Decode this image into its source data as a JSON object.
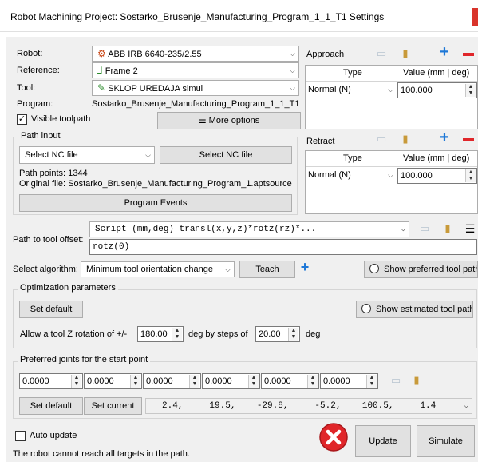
{
  "window": {
    "title": "Robot Machining Project: Sostarko_Brusenje_Manufacturing_Program_1_1_T1 Settings"
  },
  "robot": {
    "label": "Robot:",
    "value": "ABB IRB 6640-235/2.55",
    "icon": "robot-arm-icon"
  },
  "reference": {
    "label": "Reference:",
    "value": "Frame 2",
    "icon": "frame-icon"
  },
  "tool": {
    "label": "Tool:",
    "value": "SKLOP UREDAJA simul",
    "icon": "tool-icon"
  },
  "program": {
    "label": "Program:",
    "value": "Sostarko_Brusenje_Manufacturing_Program_1_1_T1"
  },
  "visible_toolpath": {
    "label": "Visible toolpath",
    "checked": true
  },
  "more_options": {
    "label": "More options",
    "icon": "hamburger-icon"
  },
  "path_input": {
    "title": "Path input",
    "select_value": "Select NC file",
    "button_label": "Select NC file",
    "path_points": "Path points: 1344",
    "original_file": "Original file: Sostarko_Brusenje_Manufacturing_Program_1.aptsource",
    "events_label": "Program Events"
  },
  "approach": {
    "label": "Approach",
    "col_type": "Type",
    "col_value": "Value (mm | deg)",
    "row_type": "Normal (N)",
    "row_value": "100.000"
  },
  "retract": {
    "label": "Retract",
    "col_type": "Type",
    "col_value": "Value (mm | deg)",
    "row_type": "Normal (N)",
    "row_value": "100.000"
  },
  "offset": {
    "label": "Path to tool offset:",
    "script": "Script (mm,deg) transl(x,y,z)*rotz(rz)*...",
    "value": "rotz(0)"
  },
  "algorithm": {
    "label": "Select algorithm:",
    "value": "Minimum tool orientation change",
    "teach_label": "Teach",
    "show_preferred": "Show preferred tool path"
  },
  "optimization": {
    "title": "Optimization parameters",
    "set_default": "Set default",
    "show_estimated": "Show estimated tool path",
    "rotation_prefix": "Allow a tool Z rotation of +/-",
    "rotation_value": "180.00",
    "rotation_middle": "deg by steps of",
    "step_value": "20.00",
    "rotation_suffix": "deg"
  },
  "preferred": {
    "title": "Preferred joints for the start point",
    "joints": [
      "0.0000",
      "0.0000",
      "0.0000",
      "0.0000",
      "0.0000",
      "0.0000"
    ],
    "set_default": "Set default",
    "set_current": "Set current",
    "current_values": "2.4,     19.5,    -29.8,     -5.2,    100.5,     1.4"
  },
  "auto_update": {
    "label": "Auto update",
    "checked": false
  },
  "status": {
    "message": "The robot cannot reach all targets in the path.",
    "icon": "error-x-icon"
  },
  "actions": {
    "update": "Update",
    "simulate": "Simulate"
  },
  "colors": {
    "error": "#e0262a",
    "accent": "#1e78d7",
    "panel": "#f0f0f0"
  }
}
